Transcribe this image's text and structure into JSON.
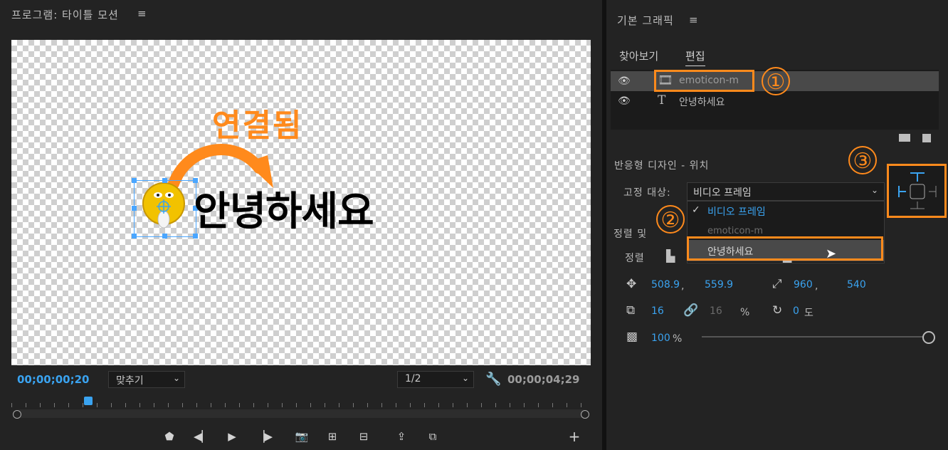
{
  "program": {
    "title": "프로그램: 타이틀 모션",
    "menu_icon": "≡",
    "canvas": {
      "annotation_text": "연결됨",
      "greeting_text": "안녕하세요"
    },
    "timecode_current": "00;00;00;20",
    "fit_select": "맞추기",
    "resolution_select": "1/2",
    "timecode_total": "00;00;04;29"
  },
  "essential_graphics": {
    "title": "기본 그래픽",
    "menu_icon": "≡",
    "tabs": [
      "찾아보기",
      "편집"
    ],
    "active_tab": "편집",
    "layers": [
      {
        "name": "emoticon-m",
        "type": "clip",
        "selected": true
      },
      {
        "name": "안녕하세요",
        "type": "text",
        "selected": false
      }
    ],
    "responsive_title": "반응형 디자인 - 위치",
    "pin_label": "고정 대상:",
    "pin_select_value": "비디오 프레임",
    "pin_options": [
      "비디오 프레임",
      "emoticon-m",
      "안녕하세요"
    ],
    "pin_option_checked": "비디오 프레임",
    "pin_option_hovered": "안녕하세요",
    "align_section": "정렬 및",
    "align_label": "정렬",
    "position": {
      "x": "508.9",
      "sep": ",",
      "y": "559.9"
    },
    "anchor": {
      "x": "960",
      "sep": ",",
      "y": "540"
    },
    "scale": {
      "value": "16",
      "linked_value": "16",
      "unit": "%"
    },
    "rotation": {
      "value": "0",
      "unit": "도"
    },
    "opacity": {
      "value": "100",
      "unit": "%",
      "level": 1.0
    }
  },
  "annotations": {
    "markers": [
      "①",
      "②",
      "③"
    ],
    "color": "#ff8a1c"
  },
  "colors": {
    "accent_blue": "#3aa3f0",
    "panel_bg": "#232323",
    "highlight": "#ff8a1c"
  }
}
